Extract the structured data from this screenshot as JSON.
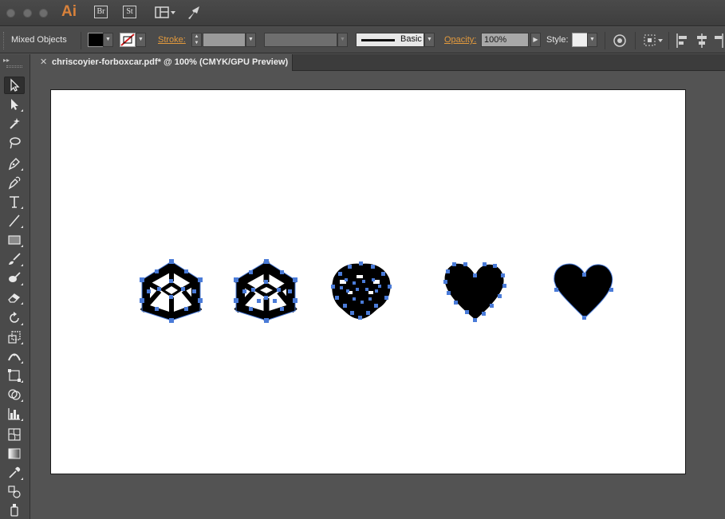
{
  "app": {
    "logo": "Ai",
    "bridge_badge": "Br",
    "stock_badge": "St"
  },
  "control_bar": {
    "selection_label": "Mixed Objects",
    "fill_color": "#000000",
    "stroke_label": "Stroke:",
    "brush_profile": "Basic",
    "opacity_label": "Opacity:",
    "opacity_value": "100%",
    "style_label": "Style:"
  },
  "document": {
    "tab_title": "chriscoyier-forboxcar.pdf* @ 100% (CMYK/GPU Preview)"
  },
  "tools": [
    "selection-tool",
    "direct-selection-tool",
    "magic-wand-tool",
    "lasso-tool",
    "pen-tool",
    "curvature-tool",
    "type-tool",
    "line-segment-tool",
    "rectangle-tool",
    "paintbrush-tool",
    "blob-brush-tool",
    "eraser-tool",
    "rotate-tool",
    "scale-tool",
    "width-tool",
    "free-transform-tool",
    "shape-builder-tool",
    "graph-tool",
    "mesh-tool",
    "gradient-tool",
    "eyedropper-tool",
    "blend-tool",
    "symbol-sprayer-tool"
  ],
  "colors": {
    "accent": "#d9823b",
    "selection_anchor": "#4a7bd8",
    "link_orange": "#e39a3d"
  }
}
